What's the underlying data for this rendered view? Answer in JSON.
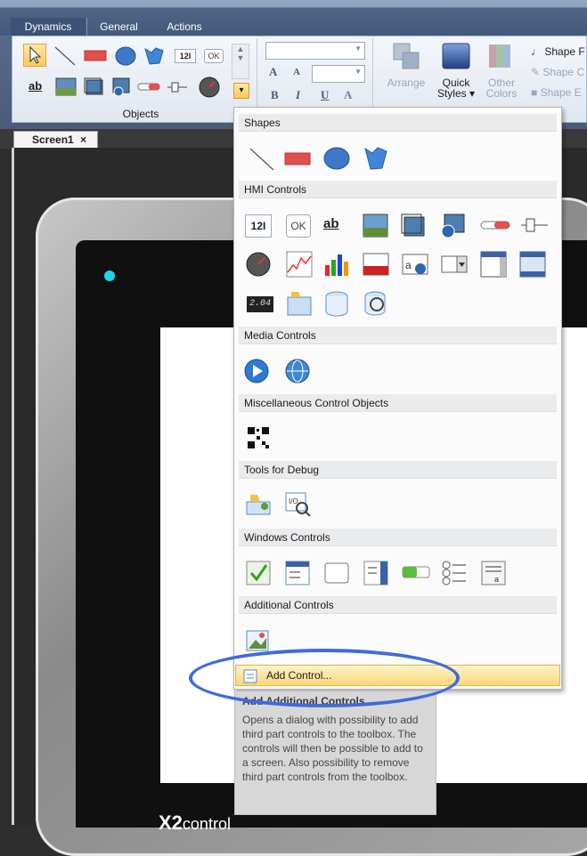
{
  "ribbon": {
    "tabs": [
      "Dynamics",
      "General",
      "Actions"
    ],
    "groups": {
      "objects_label": "Objects"
    },
    "text_tools": {
      "label_box_text": "12I",
      "ok_text": "OK",
      "ab_text": "ab"
    },
    "format": {
      "grow": "A",
      "shrink": "A",
      "bold": "B",
      "italic": "I",
      "underline": "U",
      "color": "A"
    },
    "arrange_label": "Arrange",
    "quick_styles_label_1": "Quick",
    "quick_styles_label_2": "Styles ▾",
    "other_colors_label_1": "Other",
    "other_colors_label_2": "Colors",
    "shape_fill_label": "Shape F",
    "shape_outline_label": "Shape C",
    "shape_effects_label": "Shape E"
  },
  "document": {
    "tab_label": "Screen1",
    "close_glyph": "×"
  },
  "device": {
    "model": "X2",
    "suffix": "control"
  },
  "dropdown": {
    "sections": {
      "shapes": "Shapes",
      "hmi": "HMI Controls",
      "media": "Media Controls",
      "misc": "Miscellaneous Control Objects",
      "debug": "Tools for Debug",
      "windows": "Windows Controls",
      "additional": "Additional Controls"
    },
    "hmi_text": {
      "numeric": "12I",
      "ok": "OK",
      "ab": "ab",
      "digital": "2.04"
    },
    "add_control_label": "Add Control..."
  },
  "tooltip": {
    "title": "Add Additional Controls",
    "body": "Opens a dialog with possibility to add third part controls to the toolbox. The controls will then be possible to add to a screen. Also possibility to remove third part controls from the toolbox."
  },
  "colors": {
    "accent": "#3f6ae0",
    "selection": "#fdd77a",
    "led": "#19d6ea"
  }
}
